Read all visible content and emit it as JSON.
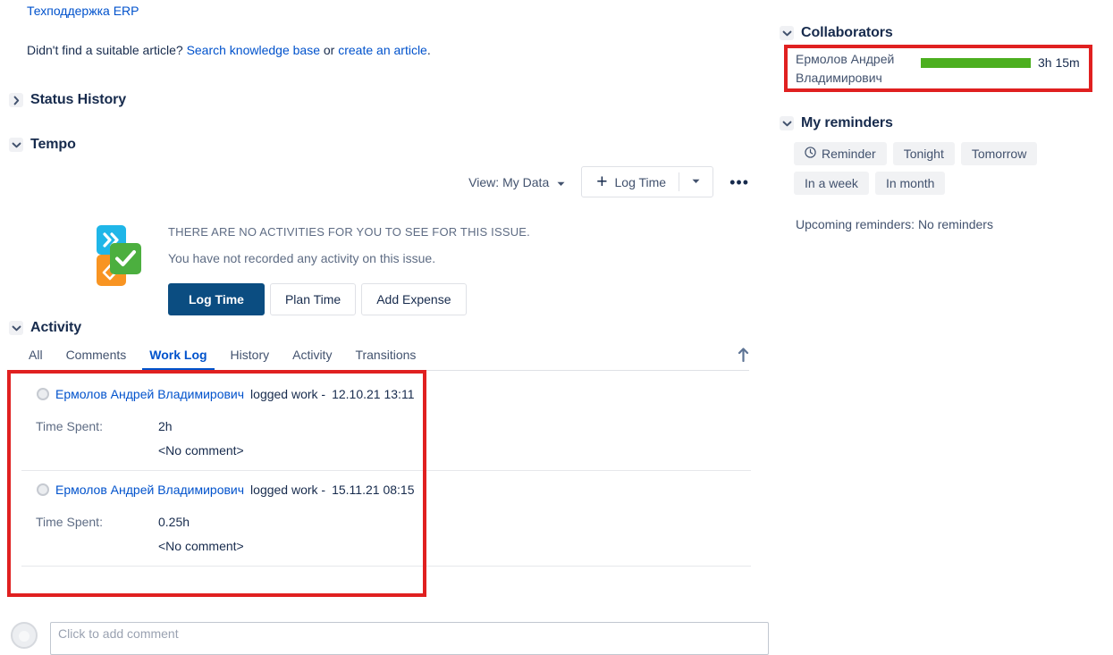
{
  "knowledge_base": {
    "link_text": "Техподдержка ERP",
    "prompt_prefix": "Didn't find a suitable article? ",
    "search_link": "Search knowledge base",
    "prompt_middle": " or ",
    "create_link": "create an article",
    "prompt_suffix": "."
  },
  "status_history": {
    "title": "Status History",
    "expanded": false
  },
  "tempo": {
    "title": "Tempo",
    "expanded": true,
    "toolbar": {
      "view_label": "View:",
      "view_value": "My Data",
      "log_time_label": "Log Time",
      "plus_icon": "plus-icon",
      "caret_icon": "chevron-down-icon",
      "more_icon": "ellipsis-icon"
    },
    "empty_state": {
      "icon": "tempo-logo-icon",
      "headline": "THERE ARE NO ACTIVITIES FOR YOU TO SEE FOR THIS ISSUE.",
      "subtext": "You have not recorded any activity on this issue.",
      "buttons": [
        {
          "label": "Log Time",
          "primary": true
        },
        {
          "label": "Plan Time",
          "primary": false
        },
        {
          "label": "Add Expense",
          "primary": false
        }
      ]
    }
  },
  "activity": {
    "title": "Activity",
    "expanded": true,
    "tabs": [
      {
        "label": "All",
        "active": false
      },
      {
        "label": "Comments",
        "active": false
      },
      {
        "label": "Work Log",
        "active": true
      },
      {
        "label": "History",
        "active": false
      },
      {
        "label": "Activity",
        "active": false
      },
      {
        "label": "Transitions",
        "active": false
      }
    ],
    "sort_icon": "sort-ascending-arrow-icon",
    "worklog_entries": [
      {
        "author": "Ермолов Андрей Владимирович",
        "action": " logged work - ",
        "timestamp": "12.10.21 13:11",
        "field_label": "Time Spent:",
        "time_spent": "2h",
        "comment": "<No comment>"
      },
      {
        "author": "Ермолов Андрей Владимирович",
        "action": " logged work - ",
        "timestamp": "15.11.21 08:15",
        "field_label": "Time Spent:",
        "time_spent": "0.25h",
        "comment": "<No comment>"
      }
    ]
  },
  "comment_box": {
    "placeholder": "Click to add comment",
    "value": "",
    "avatar": "user-avatar"
  },
  "collaborators": {
    "title": "Collaborators",
    "expanded": true,
    "rows": [
      {
        "name": "Ермолов Андрей Владимирович",
        "time": "3h 15m",
        "bar_color": "#4caf1f",
        "bar_percent": 100
      }
    ]
  },
  "reminders": {
    "title": "My reminders",
    "expanded": true,
    "chips": [
      {
        "label": "Reminder",
        "icon": "clock-icon"
      },
      {
        "label": "Tonight",
        "icon": null
      },
      {
        "label": "Tomorrow",
        "icon": null
      },
      {
        "label": "In a week",
        "icon": null
      },
      {
        "label": "In month",
        "icon": null
      }
    ],
    "upcoming_label": "Upcoming reminders: No reminders"
  },
  "annotations": {
    "highlight_color": "#e02020",
    "boxes": [
      "worklog-entries",
      "collaborators-row"
    ]
  }
}
